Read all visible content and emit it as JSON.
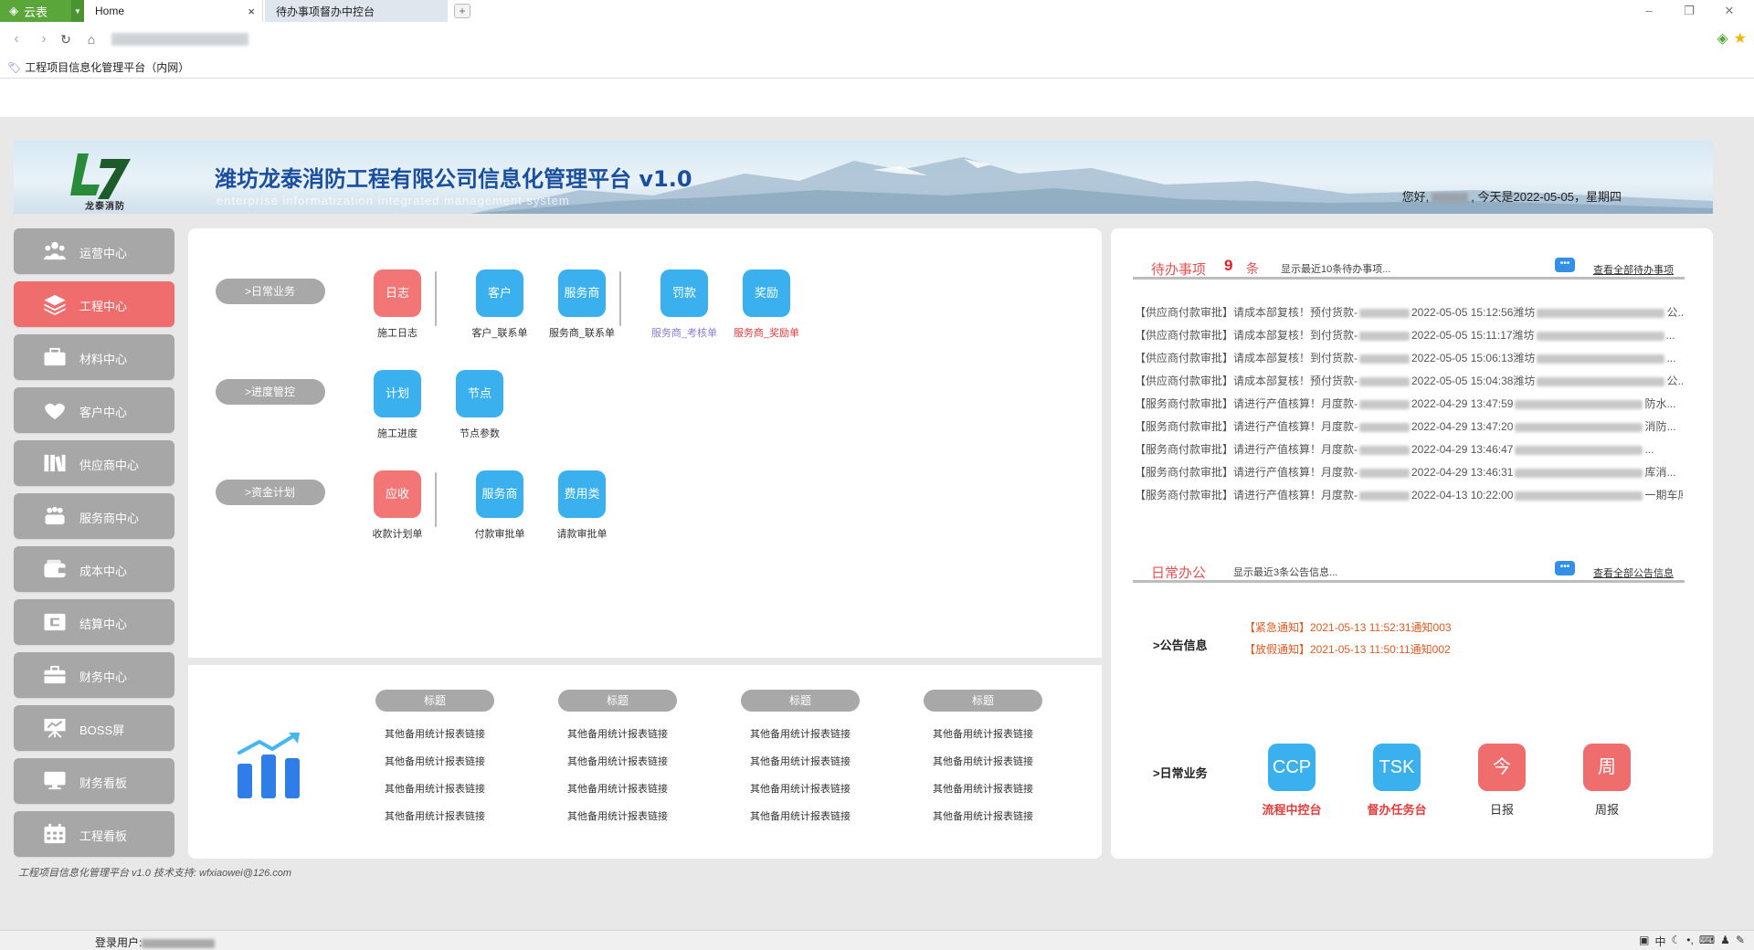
{
  "browser": {
    "brand_label": "云表",
    "tabs": [
      {
        "label": "Home"
      },
      {
        "label": "待办事项督办中控台"
      }
    ],
    "bookmark": "工程项目信息化管理平台（内网）"
  },
  "header": {
    "logo_text": "龙泰消防",
    "title": "潍坊龙泰消防工程有限公司信息化管理平台 v1.0",
    "subtitle": "enterprise informatization integrated management system",
    "greeting_prefix": "您好,",
    "greeting_suffix": ", 今天是2022-05-05，星期四"
  },
  "sidebar": {
    "items": [
      {
        "label": "运营中心",
        "icon": "people-icon"
      },
      {
        "label": "工程中心",
        "icon": "layers-icon"
      },
      {
        "label": "材料中心",
        "icon": "toolbox-icon"
      },
      {
        "label": "客户中心",
        "icon": "handshake-icon"
      },
      {
        "label": "供应商中心",
        "icon": "books-icon"
      },
      {
        "label": "服务商中心",
        "icon": "group-icon"
      },
      {
        "label": "成本中心",
        "icon": "wallet-icon"
      },
      {
        "label": "结算中心",
        "icon": "settle-icon"
      },
      {
        "label": "财务中心",
        "icon": "briefcase-icon"
      },
      {
        "label": "BOSS屏",
        "icon": "presentation-icon"
      },
      {
        "label": "财务看板",
        "icon": "monitor-icon"
      },
      {
        "label": "工程看板",
        "icon": "calendar-icon"
      }
    ],
    "active_index": 1
  },
  "workspace": {
    "sections": [
      {
        "label": ">日常业务",
        "groups": [
          [
            {
              "text": "日志",
              "caption": "施工日志",
              "color": "red"
            }
          ],
          [
            {
              "text": "客户",
              "caption": "客户_联系单",
              "color": "blue"
            },
            {
              "text": "服务商",
              "caption": "服务商_联系单",
              "color": "blue"
            }
          ],
          [
            {
              "text": "罚款",
              "caption": "服务商_考核单",
              "color": "blue",
              "caption_style": "purple"
            },
            {
              "text": "奖励",
              "caption": "服务商_奖励单",
              "color": "blue",
              "caption_style": "red"
            }
          ]
        ]
      },
      {
        "label": ">进度管控",
        "groups": [
          [
            {
              "text": "计划",
              "caption": "施工进度",
              "color": "blue"
            },
            {
              "text": "节点",
              "caption": "节点参数",
              "color": "blue"
            }
          ]
        ]
      },
      {
        "label": ">资金计划",
        "groups": [
          [
            {
              "text": "应收",
              "caption": "收款计划单",
              "color": "red"
            }
          ],
          [
            {
              "text": "服务商",
              "caption": "付款审批单",
              "color": "blue"
            },
            {
              "text": "费用类",
              "caption": "请款审批单",
              "color": "blue"
            }
          ]
        ]
      }
    ],
    "stats": {
      "columns": [
        {
          "title": "标题",
          "links": [
            "其他备用统计报表链接",
            "其他备用统计报表链接",
            "其他备用统计报表链接",
            "其他备用统计报表链接"
          ]
        },
        {
          "title": "标题",
          "links": [
            "其他备用统计报表链接",
            "其他备用统计报表链接",
            "其他备用统计报表链接",
            "其他备用统计报表链接"
          ]
        },
        {
          "title": "标题",
          "links": [
            "其他备用统计报表链接",
            "其他备用统计报表链接",
            "其他备用统计报表链接",
            "其他备用统计报表链接"
          ]
        },
        {
          "title": "标题",
          "links": [
            "其他备用统计报表链接",
            "其他备用统计报表链接",
            "其他备用统计报表链接",
            "其他备用统计报表链接"
          ]
        }
      ]
    }
  },
  "todo": {
    "title": "待办事项",
    "count": "9",
    "count_unit": "条",
    "hint": "显示最近10条待办事项...",
    "more": "查看全部待办事项",
    "items": [
      {
        "prefix": "【供应商付款审批】请成本部复核！预付货款-",
        "time": "2022-05-05 15:12:56潍坊",
        "tail": "公..."
      },
      {
        "prefix": "【供应商付款审批】请成本部复核！到付货款-",
        "time": "2022-05-05 15:11:17潍坊",
        "tail": "..."
      },
      {
        "prefix": "【供应商付款审批】请成本部复核！到付货款-",
        "time": "2022-05-05 15:06:13潍坊",
        "tail": "..."
      },
      {
        "prefix": "【供应商付款审批】请成本部复核！预付货款-",
        "time": "2022-05-05 15:04:38潍坊",
        "tail": "公..."
      },
      {
        "prefix": "【服务商付款审批】请进行产值核算！月度款-",
        "time": "2022-04-29 13:47:59",
        "tail": "防水..."
      },
      {
        "prefix": "【服务商付款审批】请进行产值核算！月度款-",
        "time": "2022-04-29 13:47:20",
        "tail": "消防..."
      },
      {
        "prefix": "【服务商付款审批】请进行产值核算！月度款-",
        "time": "2022-04-29 13:46:47",
        "tail": "..."
      },
      {
        "prefix": "【服务商付款审批】请进行产值核算！月度款-",
        "time": "2022-04-29 13:46:31",
        "tail": "库消..."
      },
      {
        "prefix": "【服务商付款审批】请进行产值核算！月度款-",
        "time": "2022-04-13 10:22:00",
        "tail": "一期车库..."
      }
    ]
  },
  "office": {
    "title": "日常办公",
    "hint": "显示最近3条公告信息...",
    "more": "查看全部公告信息",
    "notice_label": ">公告信息",
    "notices": [
      "【紧急通知】2021-05-13 11:52:31通知003",
      "【放假通知】2021-05-13 11:50:11通知002"
    ],
    "business_label": ">日常业务",
    "apps": [
      {
        "text": "CCP",
        "caption": "流程中控台",
        "color": "blue",
        "caption_style": "red"
      },
      {
        "text": "TSK",
        "caption": "督办任务台",
        "color": "blue",
        "caption_style": "red"
      },
      {
        "text": "今",
        "caption": "日报",
        "color": "red",
        "caption_style": "dark"
      },
      {
        "text": "周",
        "caption": "周报",
        "color": "red",
        "caption_style": "dark"
      }
    ]
  },
  "footer": "工程项目信息化管理平台 v1.0    技术支持:  wfxiaowei@126.com",
  "status": {
    "user_label": "登录用户:",
    "tray": "中"
  },
  "colors": {
    "active": "#f06d6d",
    "inactive": "#a7a7a7",
    "tile_blue": "#3ab1ee",
    "tile_red": "#f27676",
    "brand_green": "#5aa63a",
    "title_blue": "#1a4fa0"
  }
}
